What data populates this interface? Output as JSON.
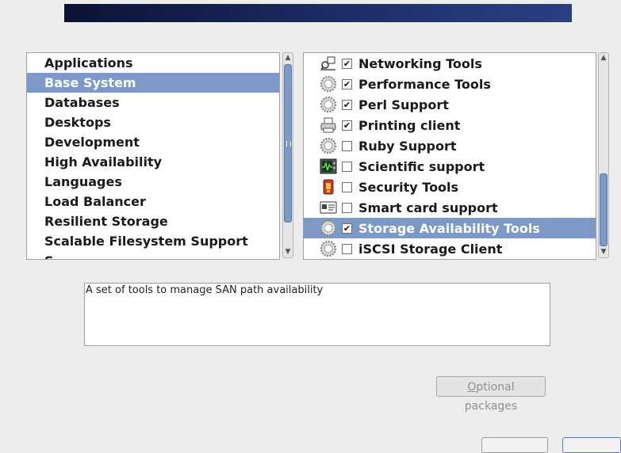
{
  "groups": {
    "items": [
      {
        "label": "Applications"
      },
      {
        "label": "Base System",
        "selected": true
      },
      {
        "label": "Databases"
      },
      {
        "label": "Desktops"
      },
      {
        "label": "Development"
      },
      {
        "label": "High Availability"
      },
      {
        "label": "Languages"
      },
      {
        "label": "Load Balancer"
      },
      {
        "label": "Resilient Storage"
      },
      {
        "label": "Scalable Filesystem Support"
      },
      {
        "label": "S..."
      }
    ]
  },
  "packages": {
    "items": [
      {
        "label": "Networking Tools",
        "icon": "network-icon",
        "checked": true
      },
      {
        "label": "Performance Tools",
        "icon": "gear-icon",
        "checked": true
      },
      {
        "label": "Perl Support",
        "icon": "gear-icon",
        "checked": true
      },
      {
        "label": "Printing client",
        "icon": "printer-icon",
        "checked": true
      },
      {
        "label": "Ruby Support",
        "icon": "gear-icon",
        "checked": false
      },
      {
        "label": "Scientific support",
        "icon": "oscilloscope-icon",
        "checked": false
      },
      {
        "label": "Security Tools",
        "icon": "security-icon",
        "checked": false
      },
      {
        "label": "Smart card support",
        "icon": "smart-card-icon",
        "checked": false
      },
      {
        "label": "Storage Availability Tools",
        "icon": "gear-icon",
        "checked": true,
        "selected": true
      },
      {
        "label": "iSCSI Storage Client",
        "icon": "gear-icon",
        "checked": false
      }
    ]
  },
  "description": {
    "text": "A set of tools to manage SAN path availability"
  },
  "optional_packages": {
    "label_first": "O",
    "label_rest": "ptional packages"
  },
  "colors": {
    "selection": "#7c99c8",
    "banner": "#1e2f6b"
  }
}
